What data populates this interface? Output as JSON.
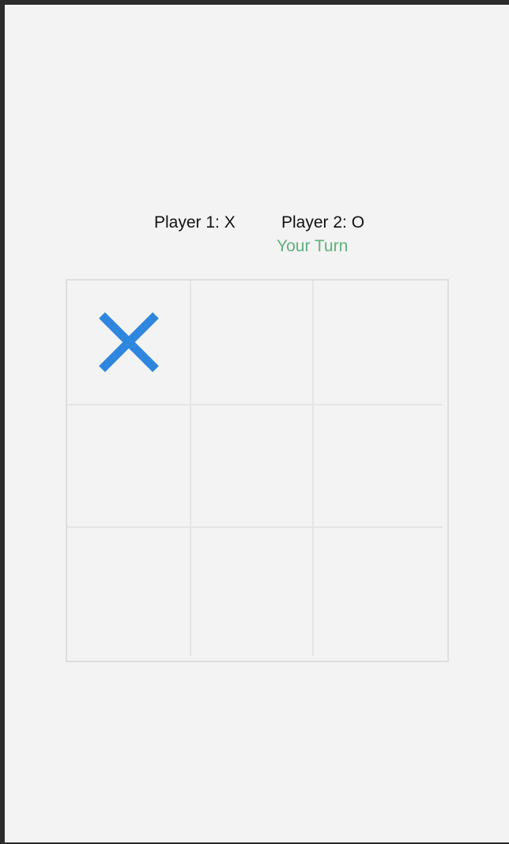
{
  "header": {
    "player1_label": "Player 1: X",
    "player2_label": "Player 2: O",
    "turn_status": "Your Turn"
  },
  "colors": {
    "background": "#f3f3f3",
    "x_mark": "#2f86de",
    "turn_text": "#5fb17e",
    "grid": "#e4e4e4",
    "board_border": "#dedede"
  },
  "board": {
    "cells": [
      [
        "X",
        "",
        ""
      ],
      [
        "",
        "",
        ""
      ],
      [
        "",
        "",
        ""
      ]
    ]
  }
}
